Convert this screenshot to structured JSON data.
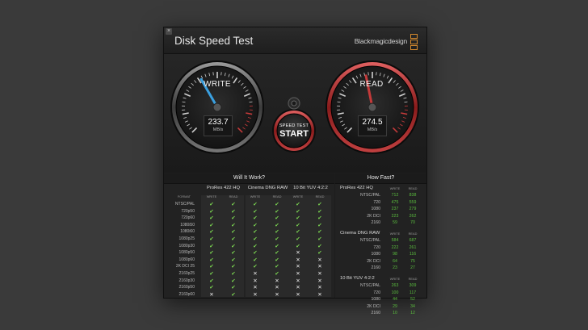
{
  "window": {
    "title": "Disk Speed Test",
    "brand": "Blackmagicdesign",
    "close_symbol": "×"
  },
  "colors": {
    "write_accent": "#3aa0e0",
    "read_accent": "#c43a3a",
    "check": "#7edb52",
    "value": "#5bbf3e"
  },
  "write_gauge": {
    "label": "WRITE",
    "value": "233.7",
    "unit": "MB/s",
    "level": 233.7
  },
  "read_gauge": {
    "label": "READ",
    "value": "274.5",
    "unit": "MB/s",
    "level": 274.5
  },
  "start_button": {
    "line1": "SPEED TEST",
    "line2": "START"
  },
  "will_it_work": {
    "title": "Will It Work?",
    "format_header": "FORMAT",
    "groups": [
      "ProRes 422 HQ",
      "Cinema DNG RAW",
      "10 Bit YUV 4:2:2"
    ],
    "subcols": [
      "WRITE",
      "READ"
    ],
    "rows": [
      {
        "format": "NTSC/PAL",
        "r": [
          1,
          1,
          1,
          1,
          1,
          1
        ]
      },
      {
        "format": "720p50",
        "r": [
          1,
          1,
          1,
          1,
          1,
          1
        ]
      },
      {
        "format": "720p60",
        "r": [
          1,
          1,
          1,
          1,
          1,
          1
        ]
      },
      {
        "format": "1080i50",
        "r": [
          1,
          1,
          1,
          1,
          1,
          1
        ]
      },
      {
        "format": "1080i60",
        "r": [
          1,
          1,
          1,
          1,
          1,
          1
        ]
      },
      {
        "format": "1080p25",
        "r": [
          1,
          1,
          1,
          1,
          1,
          1
        ]
      },
      {
        "format": "1080p30",
        "r": [
          1,
          1,
          1,
          1,
          1,
          1
        ]
      },
      {
        "format": "1080p50",
        "r": [
          1,
          1,
          1,
          1,
          0,
          1
        ]
      },
      {
        "format": "1080p60",
        "r": [
          1,
          1,
          1,
          1,
          0,
          0
        ]
      },
      {
        "format": "2K DCI 25",
        "r": [
          1,
          1,
          1,
          1,
          0,
          0
        ]
      },
      {
        "format": "2160p25",
        "r": [
          1,
          1,
          0,
          1,
          0,
          0
        ]
      },
      {
        "format": "2160p30",
        "r": [
          1,
          1,
          0,
          0,
          0,
          0
        ]
      },
      {
        "format": "2160p50",
        "r": [
          1,
          1,
          0,
          0,
          0,
          0
        ]
      },
      {
        "format": "2160p60",
        "r": [
          0,
          1,
          0,
          0,
          0,
          0
        ]
      }
    ]
  },
  "how_fast": {
    "title": "How Fast?",
    "subcols": [
      "WRITE",
      "READ"
    ],
    "sections": [
      {
        "name": "ProRes 422 HQ",
        "rows": [
          {
            "format": "NTSC/PAL",
            "write": "712",
            "read": "838"
          },
          {
            "format": "720",
            "write": "475",
            "read": "559"
          },
          {
            "format": "1080",
            "write": "237",
            "read": "279"
          },
          {
            "format": "2K DCI",
            "write": "223",
            "read": "262"
          },
          {
            "format": "2160",
            "write": "59",
            "read": "70"
          }
        ]
      },
      {
        "name": "Cinema DNG RAW",
        "rows": [
          {
            "format": "NTSC/PAL",
            "write": "584",
            "read": "687"
          },
          {
            "format": "720",
            "write": "222",
            "read": "261"
          },
          {
            "format": "1080",
            "write": "98",
            "read": "116"
          },
          {
            "format": "2K DCI",
            "write": "64",
            "read": "75"
          },
          {
            "format": "2160",
            "write": "23",
            "read": "27"
          }
        ]
      },
      {
        "name": "10 Bit YUV 4:2:2",
        "rows": [
          {
            "format": "NTSC/PAL",
            "write": "263",
            "read": "309"
          },
          {
            "format": "720",
            "write": "100",
            "read": "117"
          },
          {
            "format": "1080",
            "write": "44",
            "read": "52"
          },
          {
            "format": "2K DCI",
            "write": "29",
            "read": "34"
          },
          {
            "format": "2160",
            "write": "10",
            "read": "12"
          }
        ]
      }
    ]
  }
}
